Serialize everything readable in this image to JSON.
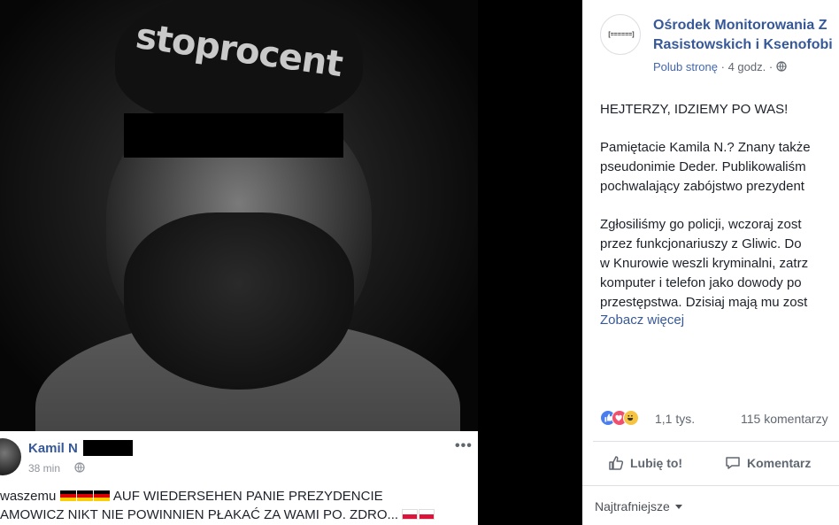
{
  "left_post": {
    "author": "Kamil N",
    "time": "38 min",
    "line1_text": "waszemu",
    "line1_flags": [
      "de",
      "de",
      "de"
    ],
    "line1_tail": "AUF WIEDERSEHEN PANIE PREZYDENCIE",
    "line2_text": "AMOWICZ NIKT NIE POWINNIEN PŁAKAĆ ZA WAMI PO. ZDRO...",
    "line2_flags": [
      "pl",
      "pl"
    ],
    "photo_cap_text": "stoprocent"
  },
  "right_post": {
    "page_name_line1": "Ośrodek Monitorowania Z",
    "page_name_line2": "Rasistowskich i Ksenofobi",
    "like_page": "Polub stronę",
    "meta_sep": "·",
    "time": "4 godz.",
    "meta_sep2": "·",
    "body_p1": "HEJTERZY, IDZIEMY PO WAS!",
    "body_p2_l1": "Pamiętacie Kamila N.? Znany także",
    "body_p2_l2": "pseudonimie Deder. Publikowaliśm",
    "body_p2_l3": "pochwalający zabójstwo prezydent",
    "body_p3_l1": "Zgłosiliśmy go policji, wczoraj zost",
    "body_p3_l2": "przez funkcjonariuszy z Gliwic. Do",
    "body_p3_l3": "w Knurowie weszli kryminalni, zatrz",
    "body_p3_l4": "komputer i telefon jako dowody po",
    "body_p3_l5": "przestępstwa. Dzisiaj mają mu zost",
    "see_more": "Zobacz więcej",
    "reaction_count": "1,1 tys.",
    "comment_count": "115 komentarzy",
    "like_button": "Lubię to!",
    "comment_button": "Komentarz",
    "sort_label": "Najtrafniejsze",
    "logo_text": "[======]"
  },
  "colors": {
    "link": "#365899",
    "text": "#1d2129",
    "muted": "#90949c"
  }
}
